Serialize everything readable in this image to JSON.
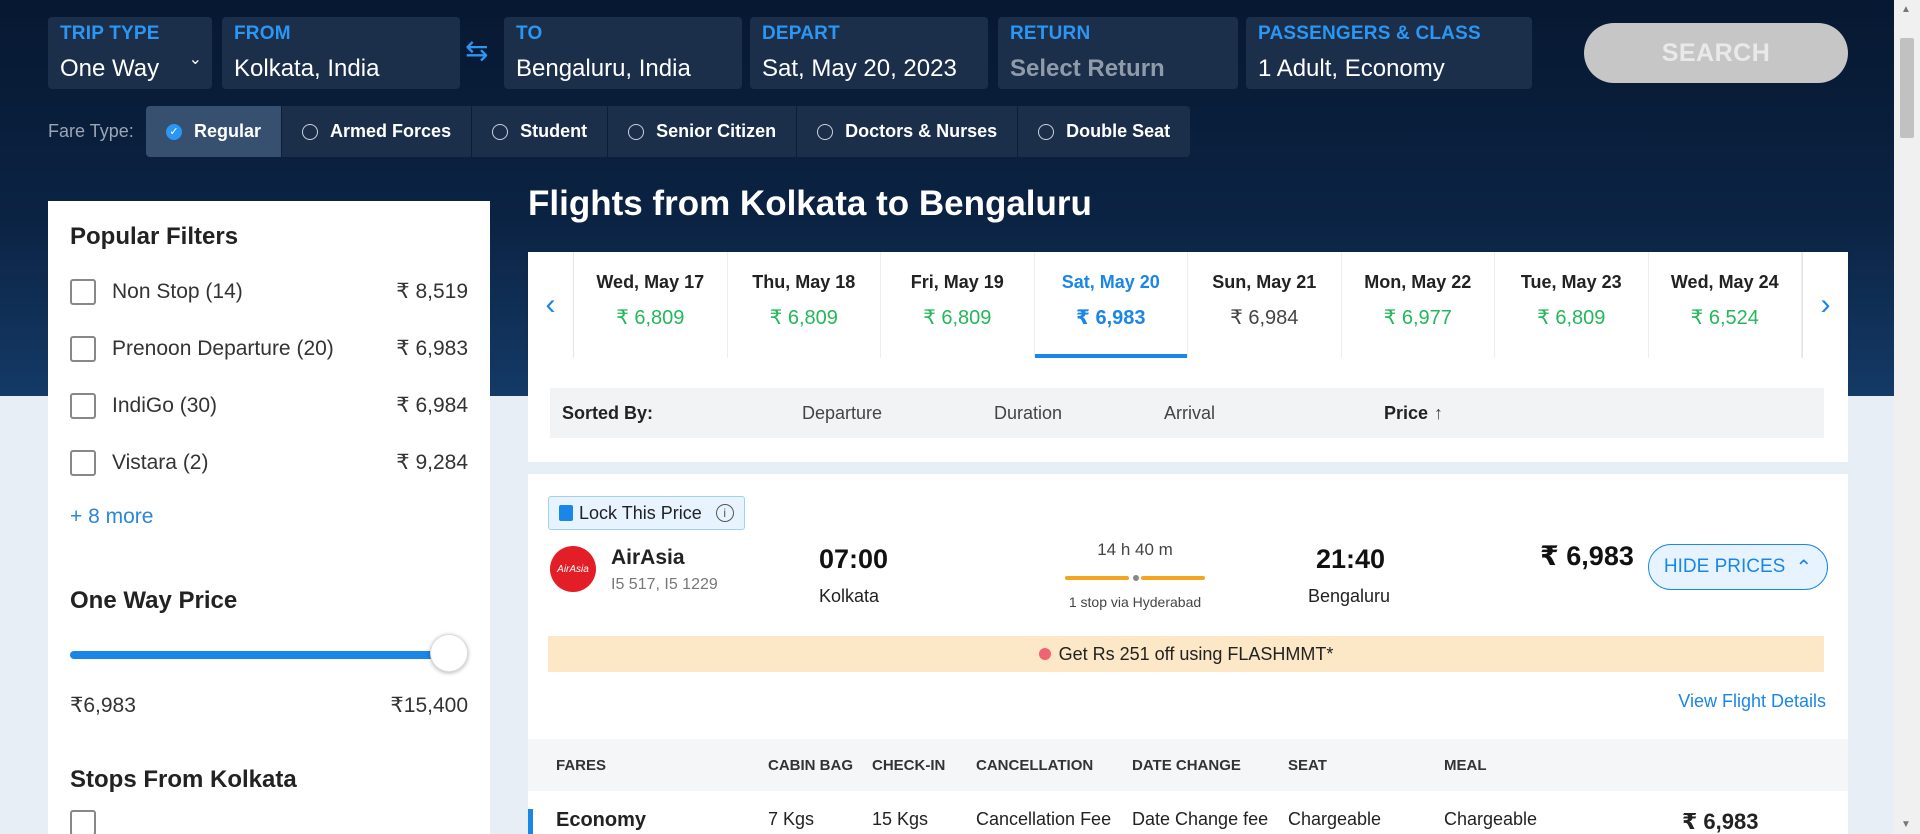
{
  "search": {
    "trip_type": {
      "label": "TRIP TYPE",
      "value": "One Way"
    },
    "from": {
      "label": "FROM",
      "value": "Kolkata, India"
    },
    "to": {
      "label": "TO",
      "value": "Bengaluru, India"
    },
    "depart": {
      "label": "DEPART",
      "value": "Sat, May 20, 2023"
    },
    "return": {
      "label": "RETURN",
      "placeholder": "Select Return"
    },
    "passengers": {
      "label": "PASSENGERS & CLASS",
      "value": "1 Adult, Economy"
    },
    "search_label": "SEARCH"
  },
  "fare_type": {
    "label": "Fare Type:",
    "options": [
      "Regular",
      "Armed Forces",
      "Student",
      "Senior Citizen",
      "Doctors & Nurses",
      "Double Seat"
    ],
    "selected": "Regular"
  },
  "sidebar": {
    "popular_title": "Popular Filters",
    "filters": [
      {
        "name": "Non Stop (14)",
        "price": "₹ 8,519"
      },
      {
        "name": "Prenoon Departure (20)",
        "price": "₹ 6,983"
      },
      {
        "name": "IndiGo (30)",
        "price": "₹ 6,984"
      },
      {
        "name": "Vistara (2)",
        "price": "₹ 9,284"
      }
    ],
    "more": "+ 8 more",
    "price_title": "One Way Price",
    "price_min": "₹6,983",
    "price_max": "₹15,400",
    "slider_fraction": 1.0,
    "stops_title": "Stops From Kolkata"
  },
  "main": {
    "title": "Flights from Kolkata to Bengaluru",
    "dates": [
      {
        "day": "Wed, May 17",
        "price": "₹ 6,809",
        "color": "green"
      },
      {
        "day": "Thu, May 18",
        "price": "₹ 6,809",
        "color": "green"
      },
      {
        "day": "Fri, May 19",
        "price": "₹ 6,809",
        "color": "green"
      },
      {
        "day": "Sat, May 20",
        "price": "₹ 6,983",
        "color": "selected"
      },
      {
        "day": "Sun, May 21",
        "price": "₹ 6,984",
        "color": "grey"
      },
      {
        "day": "Mon, May 22",
        "price": "₹ 6,977",
        "color": "green"
      },
      {
        "day": "Tue, May 23",
        "price": "₹ 6,809",
        "color": "green"
      },
      {
        "day": "Wed, May 24",
        "price": "₹ 6,524",
        "color": "green"
      }
    ],
    "sort": {
      "label": "Sorted By:",
      "departure": "Departure",
      "duration": "Duration",
      "arrival": "Arrival",
      "price": "Price",
      "price_arrow": "↑"
    }
  },
  "flight": {
    "lock_label": "Lock This Price",
    "logo_text": "AirAsia",
    "airline": "AirAsia",
    "flight_numbers": "I5 517, I5 1229",
    "dep_time": "07:00",
    "dep_city": "Kolkata",
    "duration": "14 h 40 m",
    "stops": "1 stop via Hyderabad",
    "arr_time": "21:40",
    "arr_city": "Bengaluru",
    "price": "₹ 6,983",
    "hide_prices": "HIDE PRICES",
    "promo": "Get Rs 251 off using FLASHMMT*",
    "view_details": "View Flight Details"
  },
  "fares": {
    "headers": {
      "fares": "FARES",
      "cabin": "CABIN BAG",
      "checkin": "CHECK-IN",
      "cancellation": "CANCELLATION",
      "date_change": "DATE CHANGE",
      "seat": "SEAT",
      "meal": "MEAL"
    },
    "row": {
      "name": "Economy",
      "cabin": "7 Kgs",
      "checkin": "15 Kgs",
      "cancellation": "Cancellation Fee",
      "date_change": "Date Change fee",
      "seat": "Chargeable",
      "meal": "Chargeable",
      "price": "₹ 6,983"
    }
  },
  "colors": {
    "accent": "#1a86e8",
    "green_price": "#23b85a",
    "hero_dark": "#071831",
    "promo_bg": "#fce8c6"
  }
}
